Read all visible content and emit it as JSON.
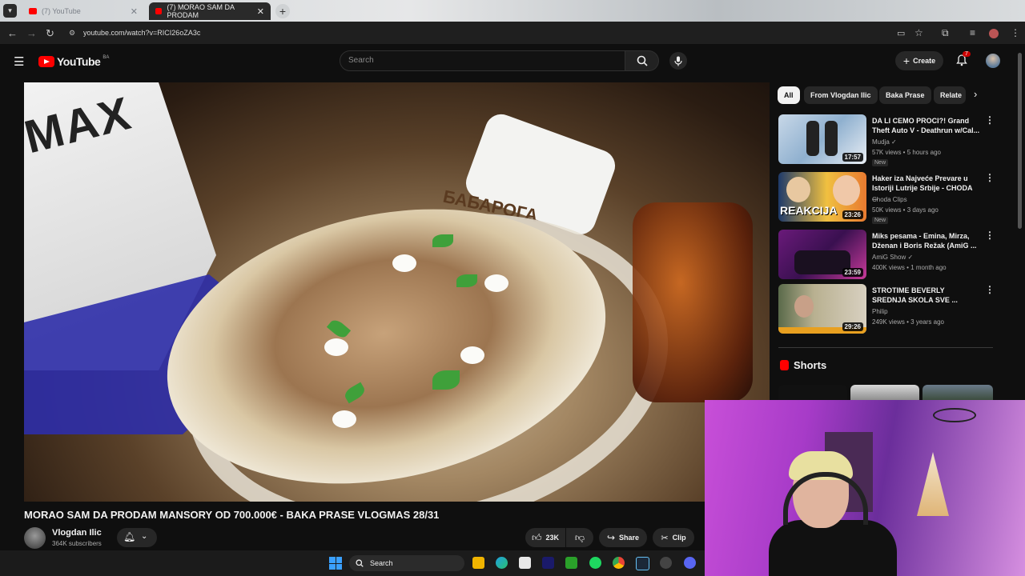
{
  "browser": {
    "tabs": [
      {
        "label": "(7) YouTube",
        "active": false
      },
      {
        "label": "(7) MORAO SAM DA PRODAM",
        "active": true
      }
    ],
    "url": "youtube.com/watch?v=RICI26oZA3c"
  },
  "header": {
    "logo": "YouTube",
    "region": "BA",
    "search_placeholder": "Search",
    "create_label": "Create",
    "notifications": "7"
  },
  "video": {
    "title": "MORAO SAM DA PRODAM MANSORY OD 700.000€ - BAKA PRASE VLOGMAS 28/31",
    "channel": "Vlogdan Ilic",
    "subscribers": "364K subscribers",
    "likes": "23K",
    "share_label": "Share",
    "clip_label": "Clip",
    "overlay_text": "MAX",
    "sign_text": "БАБАРОГА"
  },
  "chips": [
    "All",
    "From Vlogdan Ilic",
    "Baka Prase",
    "Relate"
  ],
  "recommendations": [
    {
      "title": "DA LI CEMO PROCI?! Grand Theft Auto V - Deathrun w/Cal...",
      "channel": "Mudja",
      "meta": "57K views • 5 hours ago",
      "duration": "17:57",
      "badge": "New"
    },
    {
      "title": "Haker iza Najveće Prevare u Istoriji Lutrije Srbije - CHODA ...",
      "channel": "Choda Clips",
      "meta": "50K views • 3 days ago",
      "duration": "23:26",
      "badge": "New"
    },
    {
      "title": "Miks pesama - Emina, Mirza, Dženan i Boris Režak (AmiG ...",
      "channel": "AmiG Show",
      "meta": "400K views • 1 month ago",
      "duration": "23:59",
      "badge": ""
    },
    {
      "title": "STROTIME BEVERLY SREDNJA SKOLA SVE ...",
      "channel": "Philip",
      "meta": "249K views • 3 years ago",
      "duration": "29:26",
      "badge": ""
    }
  ],
  "thumb_labels": [
    "REAKCIJA"
  ],
  "shorts_label": "Shorts",
  "taskbar": {
    "search_label": "Search"
  }
}
